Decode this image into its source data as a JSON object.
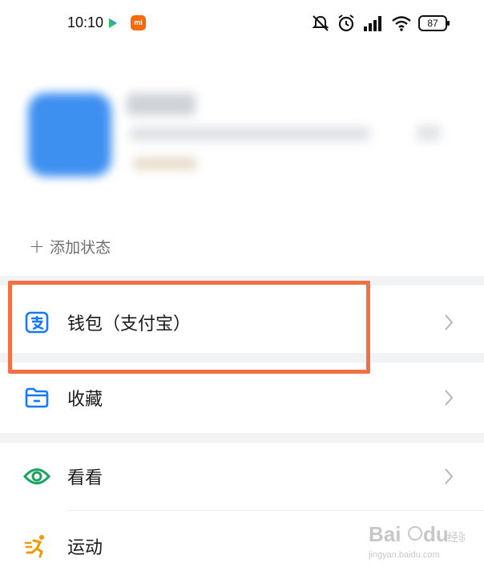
{
  "status_bar": {
    "time": "10:10",
    "mi_badge": "mi",
    "battery": "87",
    "icons": [
      "play-icon",
      "mi-icon",
      "mute-icon",
      "alarm-icon",
      "signal-icon",
      "wifi-icon",
      "battery-icon"
    ]
  },
  "profile": {
    "add_status": "添加状态"
  },
  "menu": {
    "items": [
      {
        "label": "钱包（支付宝）",
        "icon": "alipay-icon"
      },
      {
        "label": "收藏",
        "icon": "folder-icon"
      },
      {
        "label": "看看",
        "icon": "eye-icon"
      },
      {
        "label": "运动",
        "icon": "run-icon"
      }
    ]
  },
  "watermark": {
    "brand": "Baidu",
    "sub": "经验",
    "url": "jingyan.baidu.com"
  },
  "colors": {
    "highlight": "#f07143",
    "alipay_blue": "#1677ff",
    "eye_green": "#1aa260",
    "run_orange": "#f39800"
  }
}
